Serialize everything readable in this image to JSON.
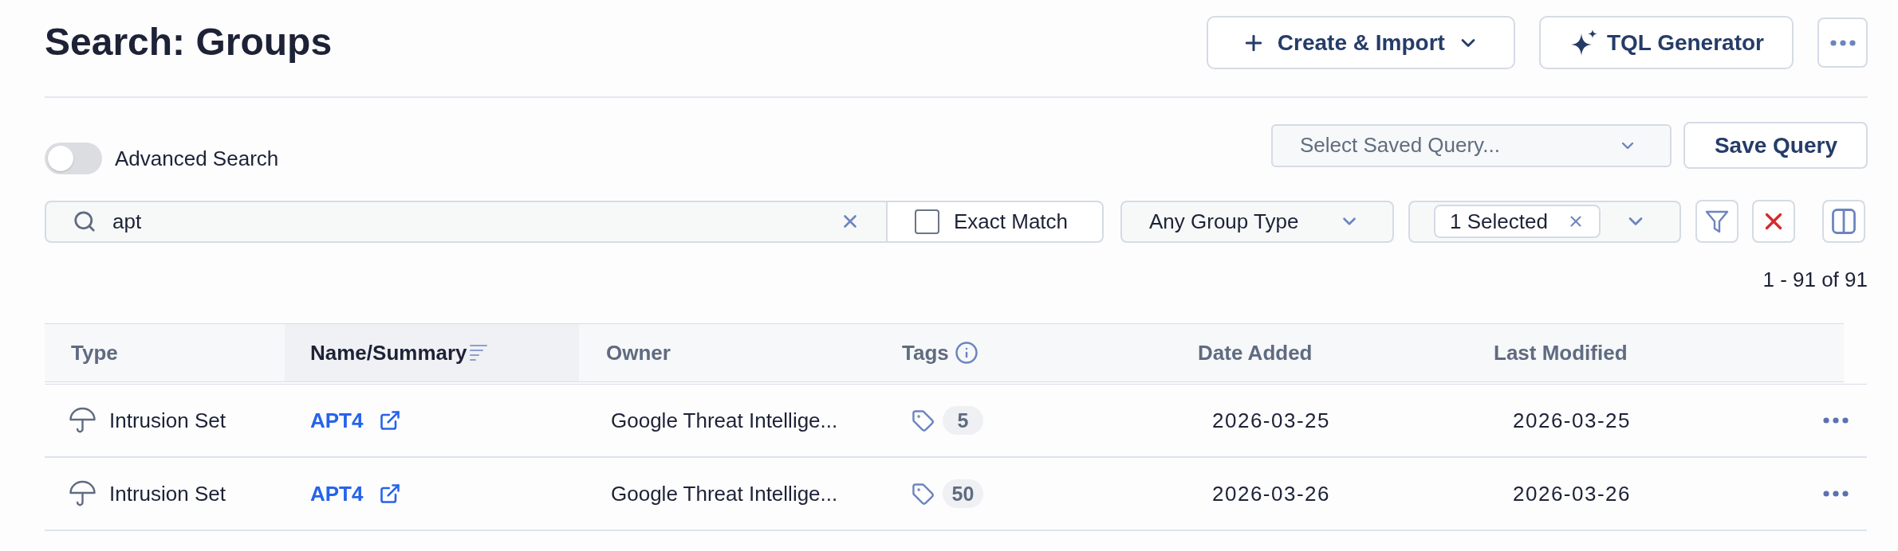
{
  "page": {
    "title": "Search: Groups"
  },
  "actions": {
    "create_import": {
      "label": "Create & Import"
    },
    "tql_generator": {
      "label": "TQL Generator"
    }
  },
  "advanced_search": {
    "label": "Advanced Search",
    "on": false
  },
  "saved_query": {
    "placeholder": "Select Saved Query..."
  },
  "save_query": {
    "label": "Save Query"
  },
  "search": {
    "value": "apt"
  },
  "exact_match": {
    "label": "Exact Match",
    "checked": false
  },
  "group_type": {
    "value": "Any Group Type"
  },
  "selection_filter": {
    "chip": "1 Selected"
  },
  "result_count": "1 - 91 of 91",
  "table": {
    "columns": [
      {
        "label": "Type",
        "sorted": false,
        "info": false
      },
      {
        "label": "Name/Summary",
        "sorted": true,
        "info": false
      },
      {
        "label": "Owner",
        "sorted": false,
        "info": false
      },
      {
        "label": "Tags",
        "sorted": false,
        "info": true
      },
      {
        "label": "Date Added",
        "sorted": false,
        "info": false
      },
      {
        "label": "Last Modified",
        "sorted": false,
        "info": false
      }
    ],
    "rows": [
      {
        "type": "Intrusion Set",
        "name": "APT4",
        "owner": "Google Threat Intellige...",
        "tags": "5",
        "date_added": "2026-03-25",
        "last_modified": "2026-03-25"
      },
      {
        "type": "Intrusion Set",
        "name": "APT4",
        "owner": "Google Threat Intellige...",
        "tags": "50",
        "date_added": "2026-03-26",
        "last_modified": "2026-03-26"
      }
    ]
  }
}
